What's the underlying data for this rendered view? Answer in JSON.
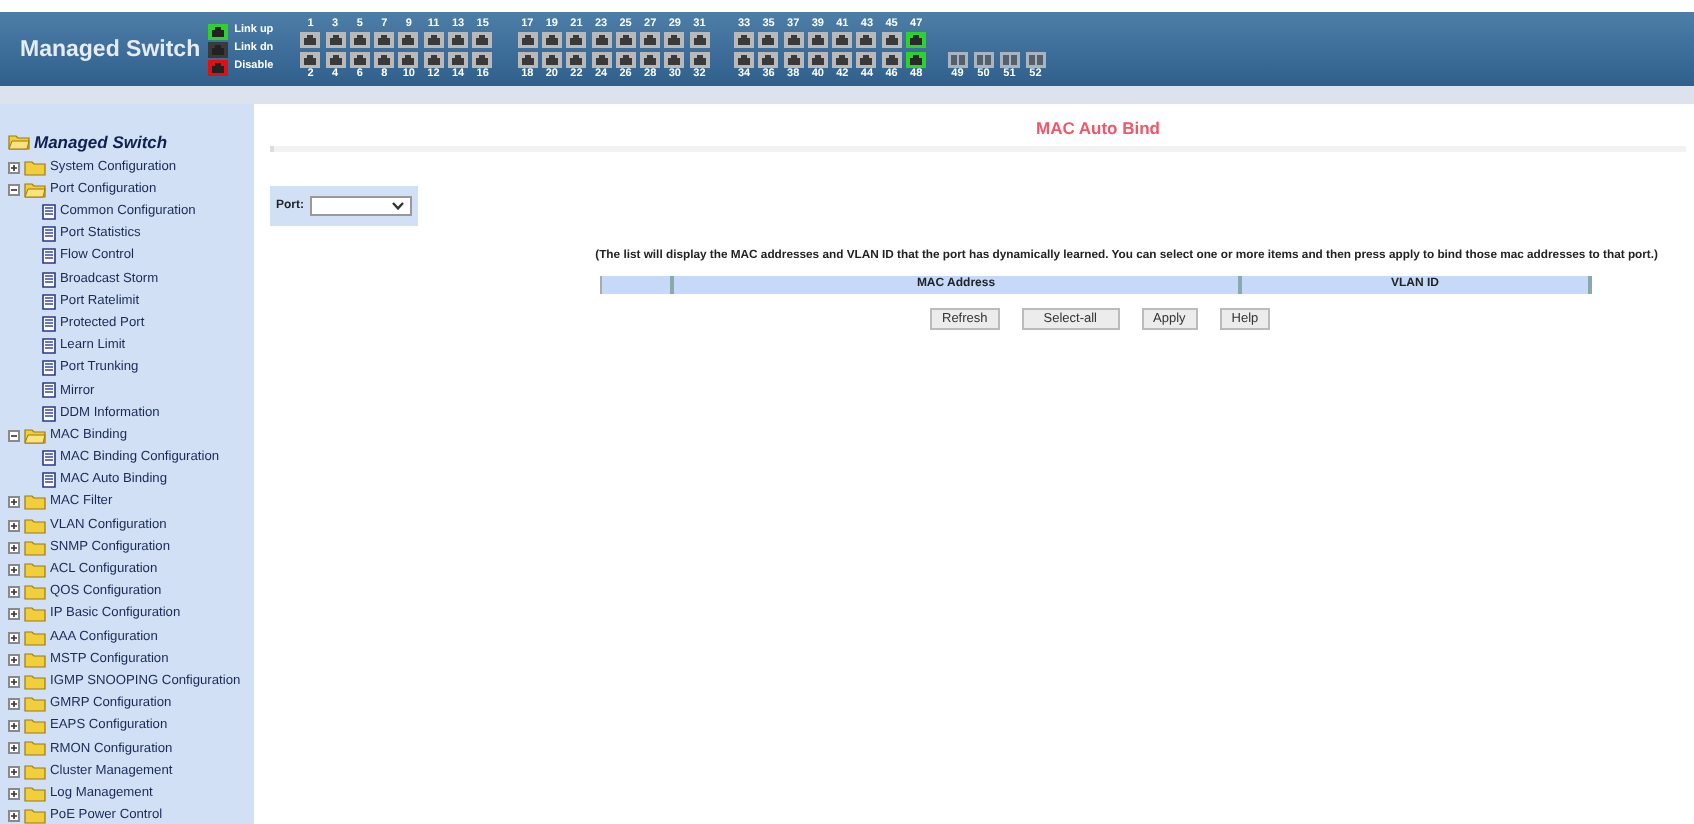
{
  "header": {
    "title": "Managed Switch",
    "legend": [
      {
        "label": "Link up",
        "color": "#2fd12f"
      },
      {
        "label": "Link dn",
        "color": "#3a3a3a"
      },
      {
        "label": "Disable",
        "color": "#e01010"
      }
    ],
    "port_groups": [
      {
        "kind": "copper",
        "ports": [
          {
            "label": "1",
            "link_up": false
          },
          {
            "label": "2",
            "link_up": false
          },
          {
            "label": "3",
            "link_up": false
          },
          {
            "label": "4",
            "link_up": false
          },
          {
            "label": "5",
            "link_up": false
          },
          {
            "label": "6",
            "link_up": false
          },
          {
            "label": "7",
            "link_up": false
          },
          {
            "label": "8",
            "link_up": false
          },
          {
            "label": "9",
            "link_up": false
          },
          {
            "label": "10",
            "link_up": false
          },
          {
            "label": "11",
            "link_up": false
          },
          {
            "label": "12",
            "link_up": false
          },
          {
            "label": "13",
            "link_up": false
          },
          {
            "label": "14",
            "link_up": false
          },
          {
            "label": "15",
            "link_up": false
          },
          {
            "label": "16",
            "link_up": false
          }
        ]
      },
      {
        "kind": "copper",
        "ports": [
          {
            "label": "17",
            "link_up": false
          },
          {
            "label": "18",
            "link_up": false
          },
          {
            "label": "19",
            "link_up": false
          },
          {
            "label": "20",
            "link_up": false
          },
          {
            "label": "21",
            "link_up": false
          },
          {
            "label": "22",
            "link_up": false
          },
          {
            "label": "23",
            "link_up": false
          },
          {
            "label": "24",
            "link_up": false
          },
          {
            "label": "25",
            "link_up": false
          },
          {
            "label": "26",
            "link_up": false
          },
          {
            "label": "27",
            "link_up": false
          },
          {
            "label": "28",
            "link_up": false
          },
          {
            "label": "29",
            "link_up": false
          },
          {
            "label": "30",
            "link_up": false
          },
          {
            "label": "31",
            "link_up": false
          },
          {
            "label": "32",
            "link_up": false
          }
        ]
      },
      {
        "kind": "copper",
        "ports": [
          {
            "label": "33",
            "link_up": false
          },
          {
            "label": "34",
            "link_up": false
          },
          {
            "label": "35",
            "link_up": false
          },
          {
            "label": "36",
            "link_up": false
          },
          {
            "label": "37",
            "link_up": false
          },
          {
            "label": "38",
            "link_up": false
          },
          {
            "label": "39",
            "link_up": false
          },
          {
            "label": "40",
            "link_up": false
          },
          {
            "label": "41",
            "link_up": false
          },
          {
            "label": "42",
            "link_up": false
          },
          {
            "label": "43",
            "link_up": false
          },
          {
            "label": "44",
            "link_up": false
          },
          {
            "label": "45",
            "link_up": false
          },
          {
            "label": "46",
            "link_up": false
          },
          {
            "label": "47",
            "link_up": true
          },
          {
            "label": "48",
            "link_up": true
          }
        ]
      },
      {
        "kind": "fiber",
        "ports": [
          {
            "label": "49",
            "link_up": false
          },
          {
            "label": "50",
            "link_up": false
          },
          {
            "label": "51",
            "link_up": false
          },
          {
            "label": "52",
            "link_up": false
          }
        ]
      }
    ]
  },
  "sidebar": {
    "root": "Managed Switch",
    "items": [
      {
        "kind": "folder",
        "label": "System Configuration",
        "expanded": false
      },
      {
        "kind": "folder",
        "label": "Port Configuration",
        "expanded": true,
        "children": [
          {
            "kind": "page",
            "label": "Common Configuration"
          },
          {
            "kind": "page",
            "label": "Port Statistics"
          },
          {
            "kind": "page",
            "label": "Flow Control"
          },
          {
            "kind": "page",
            "label": "Broadcast Storm"
          },
          {
            "kind": "page",
            "label": "Port Ratelimit"
          },
          {
            "kind": "page",
            "label": "Protected Port"
          },
          {
            "kind": "page",
            "label": "Learn Limit"
          },
          {
            "kind": "page",
            "label": "Port Trunking"
          },
          {
            "kind": "page",
            "label": "Mirror"
          },
          {
            "kind": "page",
            "label": "DDM Information"
          }
        ]
      },
      {
        "kind": "folder",
        "label": "MAC Binding",
        "expanded": true,
        "children": [
          {
            "kind": "page",
            "label": "MAC Binding Configuration"
          },
          {
            "kind": "page",
            "label": "MAC Auto Binding"
          }
        ]
      },
      {
        "kind": "folder",
        "label": "MAC Filter",
        "expanded": false
      },
      {
        "kind": "folder",
        "label": "VLAN Configuration",
        "expanded": false
      },
      {
        "kind": "folder",
        "label": "SNMP Configuration",
        "expanded": false
      },
      {
        "kind": "folder",
        "label": "ACL Configuration",
        "expanded": false
      },
      {
        "kind": "folder",
        "label": "QOS Configuration",
        "expanded": false
      },
      {
        "kind": "folder",
        "label": "IP Basic Configuration",
        "expanded": false
      },
      {
        "kind": "folder",
        "label": "AAA Configuration",
        "expanded": false
      },
      {
        "kind": "folder",
        "label": "MSTP Configuration",
        "expanded": false
      },
      {
        "kind": "folder",
        "label": "IGMP SNOOPING Configuration",
        "expanded": false
      },
      {
        "kind": "folder",
        "label": "GMRP Configuration",
        "expanded": false
      },
      {
        "kind": "folder",
        "label": "EAPS Configuration",
        "expanded": false
      },
      {
        "kind": "folder",
        "label": "RMON Configuration",
        "expanded": false
      },
      {
        "kind": "folder",
        "label": "Cluster Management",
        "expanded": false
      },
      {
        "kind": "folder",
        "label": "Log Management",
        "expanded": false
      },
      {
        "kind": "folder",
        "label": "PoE Power Control",
        "expanded": false
      }
    ]
  },
  "content": {
    "title": "MAC Auto Bind",
    "port_field": {
      "label": "Port:"
    },
    "description": "(The list will display the MAC addresses and VLAN ID that the port has dynamically learned. You can select one or more items and then press apply to bind those mac addresses to that port.)",
    "table": {
      "columns": [
        "",
        "MAC Address",
        "VLAN ID"
      ]
    },
    "buttons": [
      "Refresh",
      "Select-all",
      "Apply",
      "Help"
    ]
  }
}
